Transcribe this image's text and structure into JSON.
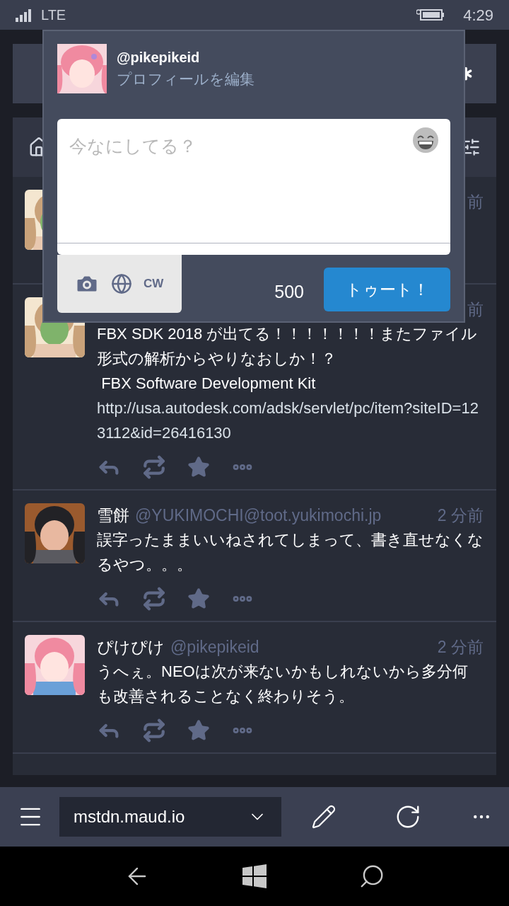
{
  "status_bar": {
    "network": "LTE",
    "time": "4:29"
  },
  "compose": {
    "handle": "@pikepikeid",
    "edit_profile": "プロフィールを編集",
    "placeholder": "今なにしてる？",
    "cw": "CW",
    "char_count": "500",
    "submit": "トゥート！"
  },
  "timeline": {
    "posts": [
      {
        "time": "前"
      },
      {
        "time": "前",
        "paragraphs": [
          {
            "kind": "text",
            "text": "FBX SDK 2018 が出てる！！！！！！！またファイル形式の解析からやりなおしか！？"
          },
          {
            "kind": "text",
            "text": " FBX Software Development Kit"
          },
          {
            "kind": "link",
            "text": "http://usa.autodesk.com/adsk/servlet/pc/item?siteID=123112&id=26416130"
          }
        ]
      },
      {
        "name": "雪餅",
        "handle": "@YUKIMOCHI@toot.yukimochi.jp",
        "time": "2 分前",
        "paragraphs": [
          {
            "kind": "text",
            "text": "誤字ったままいいねされてしまって、書き直せなくなるやつ。。。"
          }
        ]
      },
      {
        "name": "ぴけぴけ",
        "handle": "@pikepikeid",
        "time": "2 分前",
        "paragraphs": [
          {
            "kind": "text",
            "text": "うへぇ。NEOは次が来ないかもしれないから多分何も改善されることなく終わりそう。"
          }
        ]
      }
    ]
  },
  "app_bar": {
    "instance": "mstdn.maud.io"
  }
}
